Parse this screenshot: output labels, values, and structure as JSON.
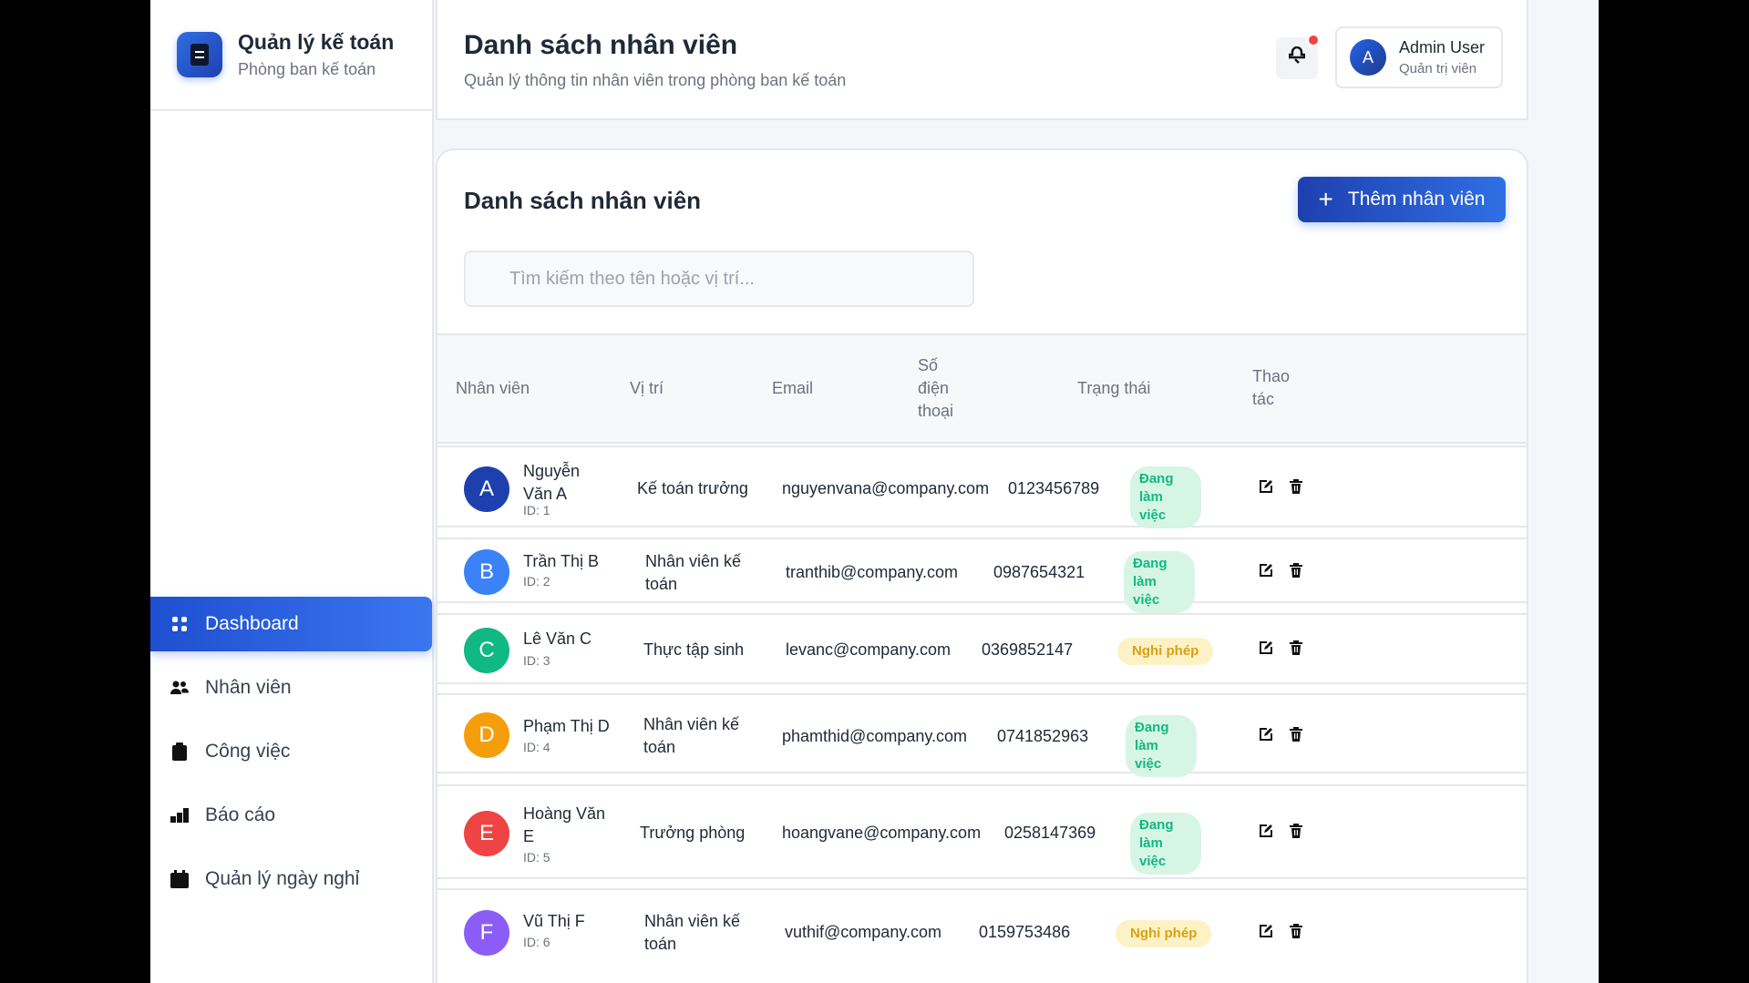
{
  "brand": {
    "title": "Quản lý kế toán",
    "subtitle": "Phòng ban kế toán",
    "icon": "document-icon"
  },
  "nav": [
    {
      "label": "Dashboard",
      "icon": "dashboard-icon",
      "active": true
    },
    {
      "label": "Nhân viên",
      "icon": "users-icon"
    },
    {
      "label": "Công việc",
      "icon": "clipboard-icon"
    },
    {
      "label": "Báo cáo",
      "icon": "chart-icon"
    },
    {
      "label": "Quản lý ngày nghỉ",
      "icon": "calendar-icon"
    }
  ],
  "header": {
    "title": "Danh sách nhân viên",
    "subtitle": "Quản lý thông tin nhân viên trong phòng ban kế toán",
    "user": {
      "initial": "A",
      "name": "Admin User",
      "role": "Quản trị viên"
    }
  },
  "card": {
    "title": "Danh sách nhân viên",
    "add_label": "Thêm nhân viên",
    "search_placeholder": "Tìm kiếm theo tên hoặc vị trí...",
    "columns": {
      "employee": "Nhân viên",
      "position": "Vị trí",
      "email": "Email",
      "phone": "Số điện thoại",
      "status": "Trạng thái",
      "actions": "Thao tác"
    }
  },
  "employees": [
    {
      "initial": "A",
      "name": "Nguyễn Văn A",
      "id": "ID: 1",
      "position": "Kế toán trưởng",
      "email": "nguyenvana@company.com",
      "phone": "0123456789",
      "status": "Đang làm việc",
      "status_type": "work",
      "color": "#1e40af"
    },
    {
      "initial": "B",
      "name": "Trần Thị B",
      "id": "ID: 2",
      "position": "Nhân viên kế toán",
      "email": "tranthib@company.com",
      "phone": "0987654321",
      "status": "Đang làm việc",
      "status_type": "work",
      "color": "#3b82f6"
    },
    {
      "initial": "C",
      "name": "Lê Văn C",
      "id": "ID: 3",
      "position": "Thực tập sinh",
      "email": "levanc@company.com",
      "phone": "0369852147",
      "status": "Nghỉ phép",
      "status_type": "leave",
      "color": "#10b981"
    },
    {
      "initial": "D",
      "name": "Phạm Thị D",
      "id": "ID: 4",
      "position": "Nhân viên kế toán",
      "email": "phamthid@company.com",
      "phone": "0741852963",
      "status": "Đang làm việc",
      "status_type": "work",
      "color": "#f59e0b"
    },
    {
      "initial": "E",
      "name": "Hoàng Văn E",
      "id": "ID: 5",
      "position": "Trưởng phòng",
      "email": "hoangvane@company.com",
      "phone": "0258147369",
      "status": "Đang làm việc",
      "status_type": "work",
      "color": "#ef4444"
    },
    {
      "initial": "F",
      "name": "Vũ Thị F",
      "id": "ID: 6",
      "position": "Nhân viên kế toán",
      "email": "vuthif@company.com",
      "phone": "0159753486",
      "status": "Nghỉ phép",
      "status_type": "leave",
      "color": "#8b5cf6"
    }
  ]
}
